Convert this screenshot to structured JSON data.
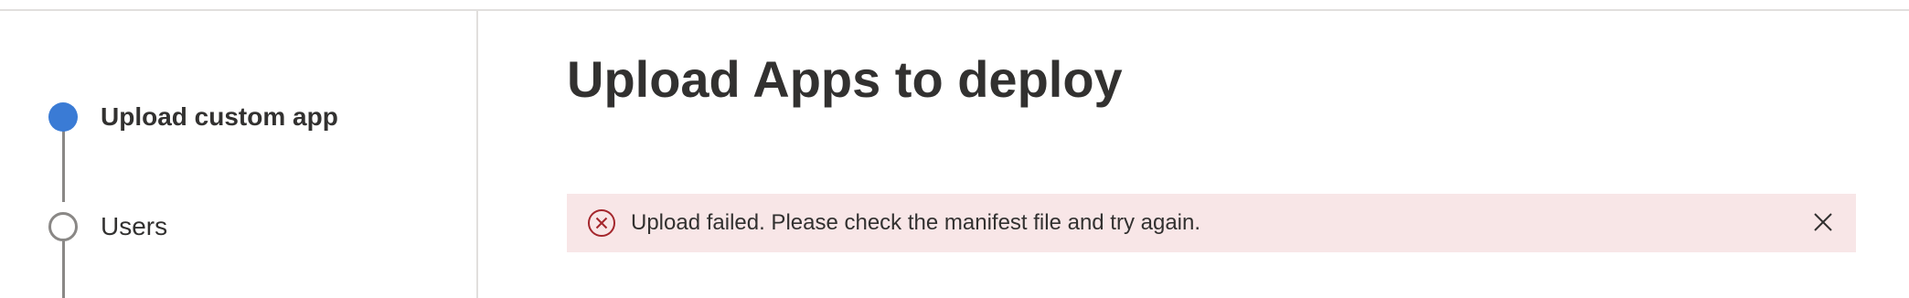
{
  "wizard": {
    "steps": [
      {
        "label": "Upload custom app",
        "state": "active"
      },
      {
        "label": "Users",
        "state": "inactive"
      }
    ]
  },
  "main": {
    "title": "Upload Apps to deploy",
    "error": {
      "message": "Upload failed. Please check the manifest file and try again.",
      "icon": "error-circle-icon",
      "dismiss_icon": "close-icon",
      "background_color": "#f8e6e7",
      "icon_color": "#a4262c"
    }
  },
  "colors": {
    "accent": "#3a7bd5",
    "inactive_step": "#8a8886",
    "divider": "#e1dfdd"
  }
}
